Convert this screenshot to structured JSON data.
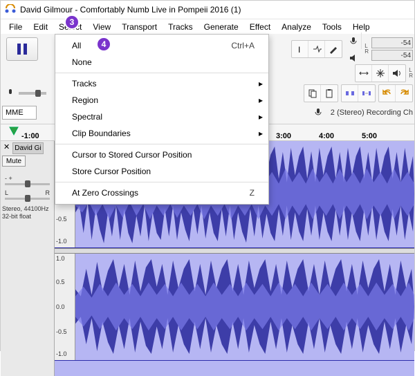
{
  "title": "David Gilmour - Comfortably Numb Live in Pompeii 2016 (1)",
  "menubar": [
    "File",
    "Edit",
    "Select",
    "View",
    "Transport",
    "Tracks",
    "Generate",
    "Effect",
    "Analyze",
    "Tools",
    "Help"
  ],
  "badges": {
    "b3": "3",
    "b4": "4"
  },
  "dropdown": {
    "all": "All",
    "all_shortcut": "Ctrl+A",
    "none": "None",
    "tracks": "Tracks",
    "region": "Region",
    "spectral": "Spectral",
    "clip": "Clip Boundaries",
    "cursor_to": "Cursor to Stored Cursor Position",
    "store": "Store Cursor Position",
    "zero": "At Zero Crossings",
    "zero_shortcut": "Z"
  },
  "toolbar": {
    "host": "MME",
    "device": "2 (Stereo) Recording Ch",
    "meter1": "-54",
    "meter2": "-54",
    "meter_lab_l": "L",
    "meter_lab_r": "R"
  },
  "ruler": {
    "t_neg1": "-1:00",
    "t3": "3:00",
    "t4": "4:00",
    "t5": "5:00"
  },
  "track": {
    "name": "David Gi",
    "close": "✕",
    "mute": "Mute",
    "gain_lab": "-         +",
    "pan_l": "L",
    "pan_r": "R",
    "meta1": "Stereo, 44100Hz",
    "meta2": "32-bit float",
    "scale_p1": "1.0",
    "scale_p05": "0.5",
    "scale_0": "0.0",
    "scale_m05": "-0.5",
    "scale_m1": "-1.0"
  },
  "icons": {
    "mic": "mic-icon",
    "speaker": "speaker-icon"
  }
}
